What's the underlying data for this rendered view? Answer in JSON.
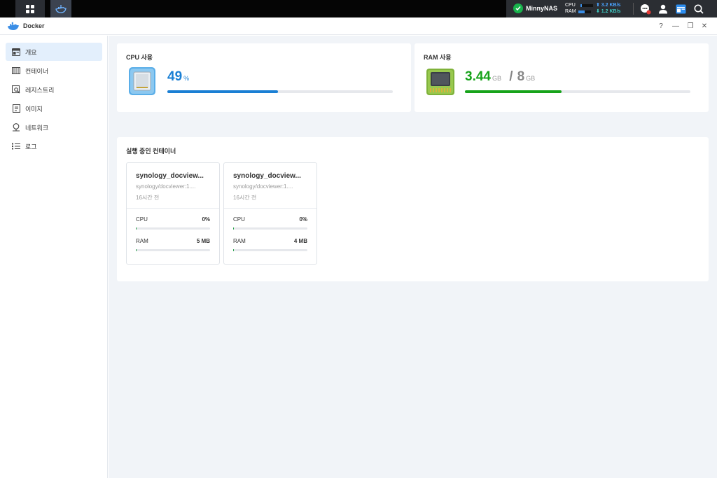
{
  "taskbar": {
    "tray": {
      "nas_name": "MinnyNAS",
      "cpu_label": "CPU",
      "ram_label": "RAM",
      "cpu_level": 0.1,
      "ram_level": 0.5,
      "upload": "⬆ 3.2 KB/s",
      "download": "⬇ 1.2 KB/s",
      "status_color": "#18b34c"
    }
  },
  "window": {
    "title": "Docker",
    "controls": {
      "help": "?",
      "minimize": "—",
      "restore": "❐",
      "close": "✕"
    }
  },
  "sidebar": {
    "items": [
      {
        "label": "개요",
        "icon": "overview-icon"
      },
      {
        "label": "컨테이너",
        "icon": "container-icon"
      },
      {
        "label": "레지스트리",
        "icon": "registry-icon"
      },
      {
        "label": "이미지",
        "icon": "image-icon"
      },
      {
        "label": "네트워크",
        "icon": "network-icon"
      },
      {
        "label": "로그",
        "icon": "log-icon"
      }
    ],
    "active_index": 0
  },
  "cpu_card": {
    "title": "CPU 사용",
    "value": "49",
    "unit": "%",
    "fraction": 0.49,
    "color": "#1a7fd4"
  },
  "ram_card": {
    "title": "RAM 사용",
    "used": "3.44",
    "used_unit": "GB",
    "separator": "/",
    "total": "8",
    "total_unit": "GB",
    "fraction": 0.43,
    "color": "#17a31a"
  },
  "running": {
    "title": "실행 중인 컨테이너",
    "containers": [
      {
        "name": "synology_docview...",
        "image": "synology/docviewer:1....",
        "time": "16시간 전",
        "cpu_label": "CPU",
        "cpu_value": "0%",
        "cpu_fraction": 0.0,
        "ram_label": "RAM",
        "ram_value": "5 MB",
        "ram_fraction": 0.01
      },
      {
        "name": "synology_docview...",
        "image": "synology/docviewer:1....",
        "time": "16시간 전",
        "cpu_label": "CPU",
        "cpu_value": "0%",
        "cpu_fraction": 0.0,
        "ram_label": "RAM",
        "ram_value": "4 MB",
        "ram_fraction": 0.01
      }
    ]
  }
}
